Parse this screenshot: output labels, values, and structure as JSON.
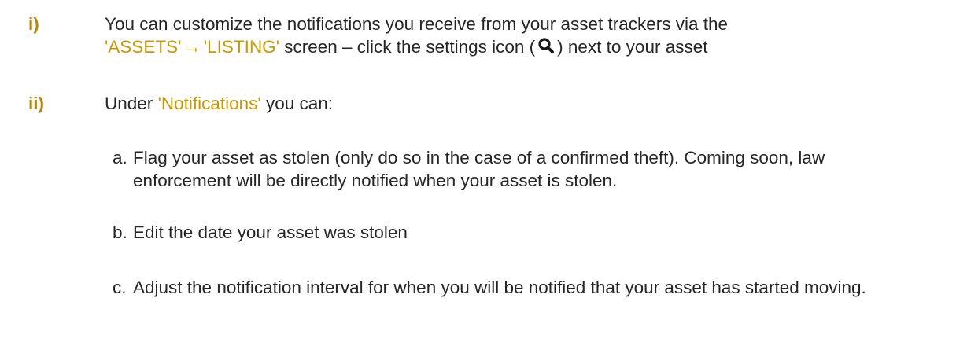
{
  "items": [
    {
      "marker": "i)",
      "text_before": "You can customize the notifications you receive from your asset trackers via the",
      "link1": "'ASSETS'",
      "arrow": "→",
      "link2": "'LISTING'",
      "text_middle": "screen – click the settings icon (",
      "icon": "search-icon",
      "text_after": ") next to your asset"
    },
    {
      "marker": "ii)",
      "text_before": "Under",
      "link": "'Notifications'",
      "text_after": "you can:"
    }
  ],
  "sub_items": [
    {
      "marker": "a.",
      "text": "Flag your asset as stolen (only do so in the case of a confirmed theft). Coming soon, law enforcement will be directly notified when your asset is stolen."
    },
    {
      "marker": "b.",
      "text": "Edit the date your asset was stolen"
    },
    {
      "marker": "c.",
      "text": "Adjust the notification interval for when you will be notified that your asset has started moving."
    }
  ],
  "colors": {
    "highlight": "#c99700",
    "marker": "#b8860b",
    "text": "#262626"
  }
}
